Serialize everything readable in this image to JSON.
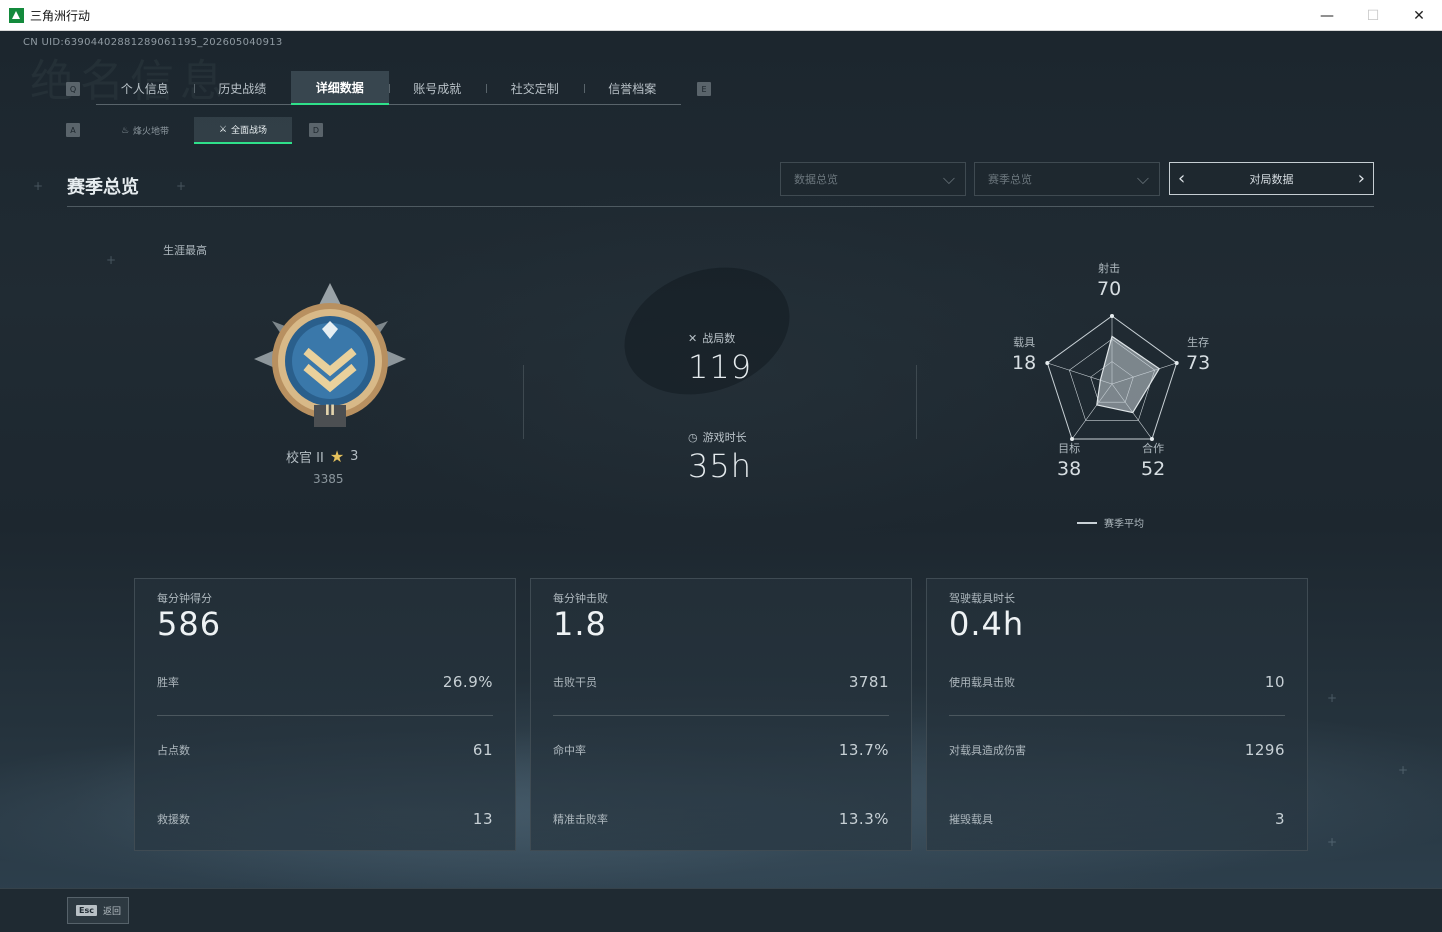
{
  "window": {
    "title": "三角洲行动",
    "minimize": "—",
    "maximize": "☐",
    "close": "✕"
  },
  "uid": "CN UID:6390440288128906119​5_202605040913",
  "watermark": "绝名信息",
  "key_hints": {
    "prev_tab": "Q",
    "next_tab": "E",
    "prev_sub": "A",
    "next_sub": "D"
  },
  "tabs": [
    {
      "label": "个人信息"
    },
    {
      "label": "历史战绩"
    },
    {
      "label": "详细数据",
      "active": true
    },
    {
      "label": "账号成就"
    },
    {
      "label": "社交定制"
    },
    {
      "label": "信誉档案"
    }
  ],
  "subtabs": [
    {
      "label": "烽火地带",
      "icon": "flame-icon"
    },
    {
      "label": "全面战场",
      "icon": "battlefield-icon",
      "active": true
    }
  ],
  "section_title": "赛季总览",
  "filters": {
    "data_dropdown": "数据总览",
    "season_dropdown": "赛季总览",
    "pager_label": "对局数据"
  },
  "rank": {
    "career_label": "生涯最高",
    "name": "校官 II",
    "stars": "3",
    "points": "3385",
    "numeral": "II"
  },
  "summary": {
    "matches_label": "战局数",
    "matches_value": "119",
    "playtime_label": "游戏时长",
    "playtime_value": "35h"
  },
  "radar": {
    "axes": [
      {
        "name": "射击",
        "value": "70",
        "score": 70
      },
      {
        "name": "生存",
        "value": "73",
        "score": 73
      },
      {
        "name": "合作",
        "value": "52",
        "score": 52
      },
      {
        "name": "目标",
        "value": "38",
        "score": 38
      },
      {
        "name": "载具",
        "value": "18",
        "score": 18
      }
    ],
    "legend": "赛季平均"
  },
  "cards": [
    {
      "head_label": "每分钟得分",
      "head_value": "586",
      "rows": [
        {
          "k": "胜率",
          "v": "26.9%"
        },
        {
          "k": "占点数",
          "v": "61"
        },
        {
          "k": "救援数",
          "v": "13"
        }
      ]
    },
    {
      "head_label": "每分钟击败",
      "head_value": "1.8",
      "rows": [
        {
          "k": "击败干员",
          "v": "3781"
        },
        {
          "k": "命中率",
          "v": "13.7%"
        },
        {
          "k": "精准击败率",
          "v": "13.3%"
        }
      ]
    },
    {
      "head_label": "驾驶载具时长",
      "head_value": "0.4h",
      "rows": [
        {
          "k": "使用载具击败",
          "v": "10"
        },
        {
          "k": "对载具造成伤害",
          "v": "1296"
        },
        {
          "k": "摧毁载具",
          "v": "3"
        }
      ]
    }
  ],
  "bottom": {
    "esc_key": "Esc",
    "back_label": "返回"
  }
}
